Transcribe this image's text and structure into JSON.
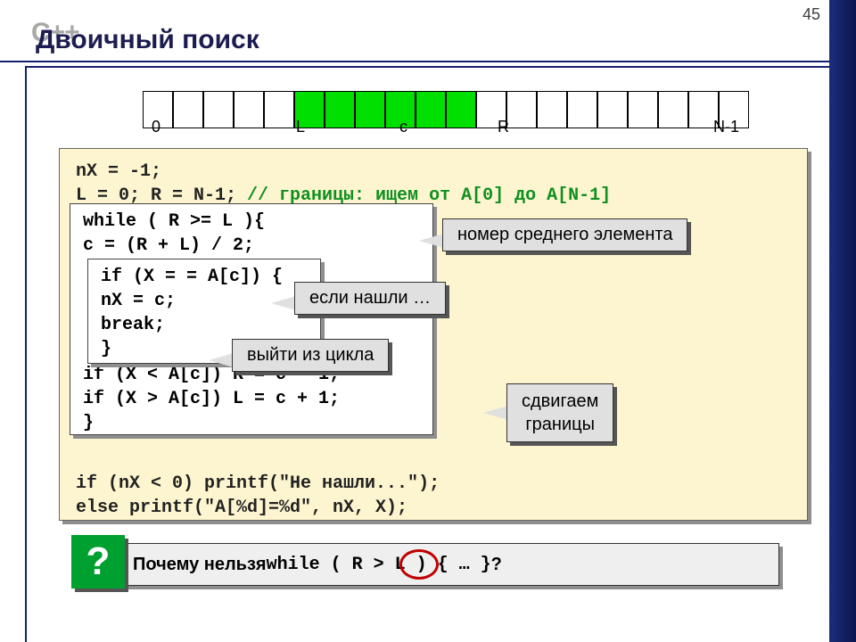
{
  "page_number": "45",
  "logo": "C++",
  "title": "Двоичный поиск",
  "array_labels": {
    "zero": "0",
    "L": "L",
    "c": "c",
    "R": "R",
    "Nm1": "N-1"
  },
  "highlight_range": [
    5,
    6,
    7,
    8,
    9,
    10
  ],
  "code": {
    "l1": "nX = -1;",
    "l2a": "L = 0; R = N-1; ",
    "l2b": "// границы: ищем от A[0] до A[N-1]",
    "inner1": {
      "l1": "while ( R >= L ){",
      "l2": "  c = (R + L) / 2;",
      "l7": "  if (X < A[c]) R = c - 1;",
      "l8": "  if (X > A[c]) L = c + 1;",
      "l9": "  }"
    },
    "inner2": {
      "l1": "if (X = = A[c]) {",
      "l2": "  nX = c;",
      "l3": "  break;",
      "l4": "  }"
    },
    "l9": "if (nX < 0) printf(\"Не нашли...\");",
    "l10": "else        printf(\"A[%d]=%d\", nX, X);"
  },
  "callouts": {
    "c1": "номер среднего элемента",
    "c2": "если нашли …",
    "c3": "выйти из цикла",
    "c4_l1": "сдвигаем",
    "c4_l2": "границы"
  },
  "question": {
    "mark": "?",
    "pre": "Почему нельзя ",
    "code": "while ( R > L ) { … }",
    "post": " ?"
  }
}
